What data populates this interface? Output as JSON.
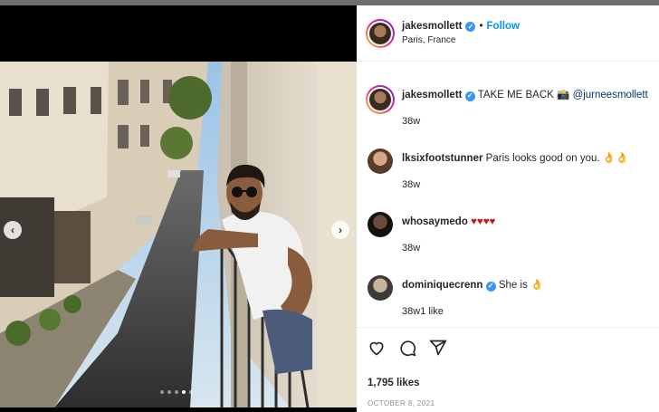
{
  "post": {
    "username": "jakesmollett",
    "follow_label": "Follow",
    "separator": "•",
    "location": "Paris, France",
    "verified": true
  },
  "caption": {
    "username": "jakesmollett",
    "text": "TAKE ME BACK",
    "camera_emoji": "📸",
    "mention": "@jurneesmollett",
    "age": "38w"
  },
  "comments": [
    {
      "username": "lksixfootstunner",
      "text": "Paris looks good on you.",
      "emoji": "👌👌",
      "age": "38w",
      "likes": "",
      "verified": false
    },
    {
      "username": "whosaymedo",
      "text": "",
      "emoji": "♥♥♥♥",
      "age": "38w",
      "likes": "",
      "verified": false
    },
    {
      "username": "dominiquecrenn",
      "text": "She is",
      "emoji": "👌",
      "age": "38w",
      "likes": "1 like",
      "verified": true
    }
  ],
  "actions": {
    "likes": "1,795 likes",
    "date": "OCTOBER 8, 2021",
    "icons": [
      "heart-icon",
      "comment-icon",
      "share-icon"
    ]
  },
  "carousel": {
    "slide_count": 5,
    "active_index": 3
  },
  "colors": {
    "accent": "#0095f6",
    "verified": "#3897f0",
    "heart": "#c41a1a"
  }
}
